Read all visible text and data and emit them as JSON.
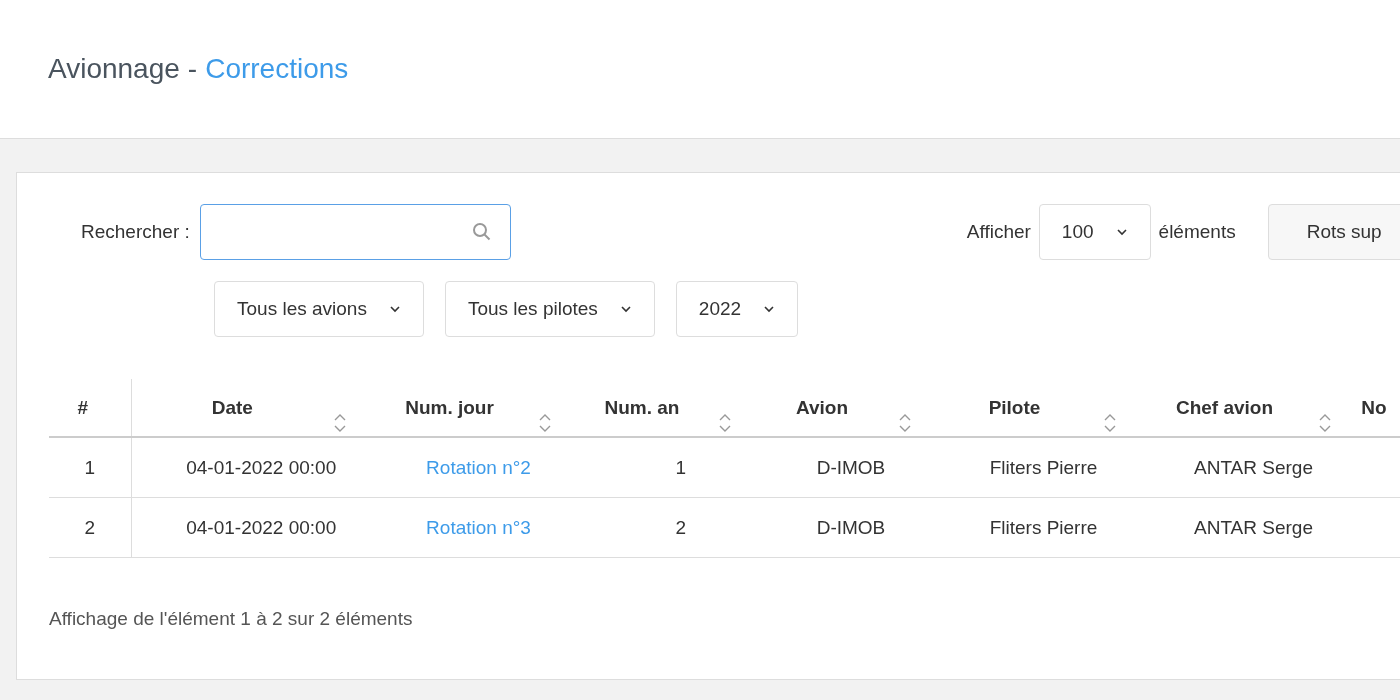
{
  "header": {
    "section": "Avionnage",
    "separator": "-",
    "subsection": "Corrections"
  },
  "search": {
    "label": "Rechercher :"
  },
  "page_length": {
    "prefix": "Afficher",
    "value": "100",
    "suffix": "éléments"
  },
  "buttons": [
    "Rots sup"
  ],
  "filters": [
    {
      "value": "Tous les avions"
    },
    {
      "value": "Tous les pilotes"
    },
    {
      "value": "2022"
    }
  ],
  "table": {
    "columns": [
      {
        "label": "#",
        "sortable": false,
        "kind": "index"
      },
      {
        "label": "Date",
        "sortable": true,
        "kind": "text"
      },
      {
        "label": "Num. jour",
        "sortable": true,
        "kind": "link"
      },
      {
        "label": "Num. an",
        "sortable": true,
        "kind": "number"
      },
      {
        "label": "Avion",
        "sortable": true,
        "kind": "text"
      },
      {
        "label": "Pilote",
        "sortable": true,
        "kind": "text"
      },
      {
        "label": "Chef avion",
        "sortable": true,
        "kind": "text"
      },
      {
        "label": "No",
        "sortable": false,
        "kind": "text"
      }
    ],
    "rows": [
      {
        "cells": [
          "1",
          "04-01-2022 00:00",
          "Rotation n°2",
          "1",
          "D-IMOB",
          "Fliters Pierre",
          "ANTAR Serge"
        ]
      },
      {
        "cells": [
          "2",
          "04-01-2022 00:00",
          "Rotation n°3",
          "2",
          "D-IMOB",
          "Fliters Pierre",
          "ANTAR Serge"
        ]
      }
    ]
  },
  "info": "Affichage de l'élément 1 à 2 sur 2 éléments"
}
